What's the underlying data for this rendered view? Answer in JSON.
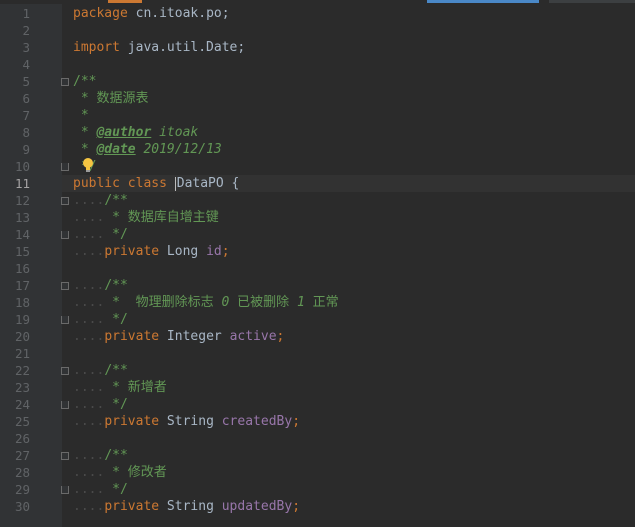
{
  "colors": {
    "background": "#2b2b2b",
    "gutter": "#313335",
    "keyword": "#cc7832",
    "javadoc": "#629755",
    "field": "#9876aa",
    "plain": "#a9b7c6",
    "line_number": "#606366",
    "current_line": "#323232"
  },
  "editor": {
    "current_line": 11,
    "line_numbers": [
      "1",
      "2",
      "3",
      "4",
      "5",
      "6",
      "7",
      "8",
      "9",
      "10",
      "11",
      "12",
      "13",
      "14",
      "15",
      "16",
      "17",
      "18",
      "19",
      "20",
      "21",
      "22",
      "23",
      "24",
      "25",
      "26",
      "27",
      "28",
      "29",
      "30"
    ],
    "lines": [
      [
        {
          "t": "package",
          "c": "kw"
        },
        {
          "t": " cn.itoak.po;",
          "c": "p"
        }
      ],
      [],
      [
        {
          "t": "import",
          "c": "kw"
        },
        {
          "t": " java.util.Date;",
          "c": "p"
        }
      ],
      [],
      [
        {
          "t": "/**",
          "c": "doc"
        }
      ],
      [
        {
          "t": " * 数据源表",
          "c": "doc"
        }
      ],
      [
        {
          "t": " *",
          "c": "doc"
        }
      ],
      [
        {
          "t": " * ",
          "c": "doc"
        },
        {
          "t": "@author",
          "c": "doc-tag"
        },
        {
          "t": " itoak",
          "c": "doc-it"
        }
      ],
      [
        {
          "t": " * ",
          "c": "doc"
        },
        {
          "t": "@date",
          "c": "doc-tag"
        },
        {
          "t": " 2019/12/13",
          "c": "doc-it"
        }
      ],
      [
        {
          "t": " */",
          "c": "doc"
        }
      ],
      [
        {
          "t": "public class ",
          "c": "kw"
        },
        {
          "t": "",
          "c": "caret"
        },
        {
          "t": "DataPO {",
          "c": "p"
        }
      ],
      [
        {
          "t": "....",
          "c": "dots"
        },
        {
          "t": "/**",
          "c": "doc"
        }
      ],
      [
        {
          "t": "....",
          "c": "dots"
        },
        {
          "t": " * 数据库自增主键",
          "c": "doc"
        }
      ],
      [
        {
          "t": "....",
          "c": "dots"
        },
        {
          "t": " */",
          "c": "doc"
        }
      ],
      [
        {
          "t": "....",
          "c": "dots"
        },
        {
          "t": "private",
          "c": "kw"
        },
        {
          "t": " Long ",
          "c": "p"
        },
        {
          "t": "id",
          "c": "field"
        },
        {
          "t": ";",
          "c": "kw"
        }
      ],
      [],
      [
        {
          "t": "....",
          "c": "dots"
        },
        {
          "t": "/**",
          "c": "doc"
        }
      ],
      [
        {
          "t": "....",
          "c": "dots"
        },
        {
          "t": " *  物理删除标志 ",
          "c": "doc"
        },
        {
          "t": "0",
          "c": "doc-it"
        },
        {
          "t": " 已被删除 ",
          "c": "doc"
        },
        {
          "t": "1",
          "c": "doc-it"
        },
        {
          "t": " 正常",
          "c": "doc"
        }
      ],
      [
        {
          "t": "....",
          "c": "dots"
        },
        {
          "t": " */",
          "c": "doc"
        }
      ],
      [
        {
          "t": "....",
          "c": "dots"
        },
        {
          "t": "private",
          "c": "kw"
        },
        {
          "t": " Integer ",
          "c": "p"
        },
        {
          "t": "active",
          "c": "field"
        },
        {
          "t": ";",
          "c": "kw"
        }
      ],
      [],
      [
        {
          "t": "....",
          "c": "dots"
        },
        {
          "t": "/**",
          "c": "doc"
        }
      ],
      [
        {
          "t": "....",
          "c": "dots"
        },
        {
          "t": " * 新增者",
          "c": "doc"
        }
      ],
      [
        {
          "t": "....",
          "c": "dots"
        },
        {
          "t": " */",
          "c": "doc"
        }
      ],
      [
        {
          "t": "....",
          "c": "dots"
        },
        {
          "t": "private",
          "c": "kw"
        },
        {
          "t": " String ",
          "c": "p"
        },
        {
          "t": "createdBy",
          "c": "field"
        },
        {
          "t": ";",
          "c": "kw"
        }
      ],
      [],
      [
        {
          "t": "....",
          "c": "dots"
        },
        {
          "t": "/**",
          "c": "doc"
        }
      ],
      [
        {
          "t": "....",
          "c": "dots"
        },
        {
          "t": " * 修改者",
          "c": "doc"
        }
      ],
      [
        {
          "t": "....",
          "c": "dots"
        },
        {
          "t": " */",
          "c": "doc"
        }
      ],
      [
        {
          "t": "....",
          "c": "dots"
        },
        {
          "t": "private",
          "c": "kw"
        },
        {
          "t": " String ",
          "c": "p"
        },
        {
          "t": "updatedBy",
          "c": "field"
        },
        {
          "t": ";",
          "c": "kw"
        }
      ]
    ],
    "fold_markers": [
      {
        "line": 5,
        "kind": "open"
      },
      {
        "line": 10,
        "kind": "close"
      },
      {
        "line": 12,
        "kind": "open"
      },
      {
        "line": 14,
        "kind": "close"
      },
      {
        "line": 17,
        "kind": "open"
      },
      {
        "line": 19,
        "kind": "close"
      },
      {
        "line": 22,
        "kind": "open"
      },
      {
        "line": 24,
        "kind": "close"
      },
      {
        "line": 27,
        "kind": "open"
      },
      {
        "line": 29,
        "kind": "close"
      }
    ],
    "intention_icon": "lightbulb-icon"
  }
}
